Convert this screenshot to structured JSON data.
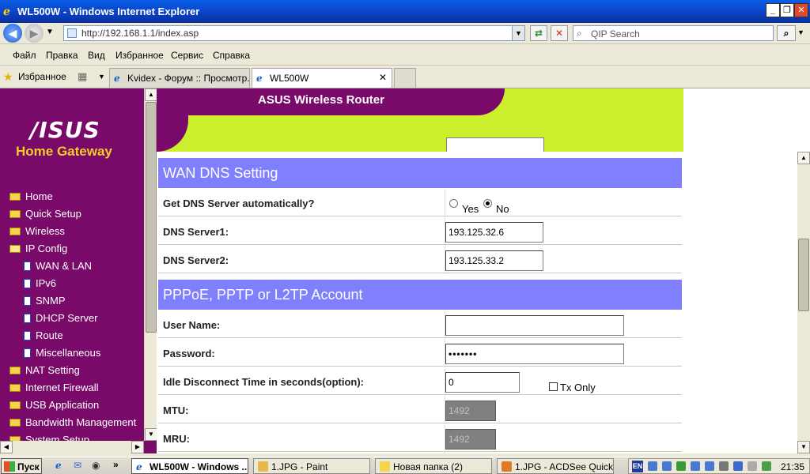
{
  "window": {
    "title": "WL500W - Windows Internet Explorer"
  },
  "browser": {
    "address": "http://192.168.1.1/index.asp",
    "search_placeholder": "QIP Search",
    "menu": [
      "Файл",
      "Правка",
      "Вид",
      "Избранное",
      "Сервис",
      "Справка"
    ],
    "favorites_label": "Избранное",
    "tabs": [
      {
        "label": "Kvidex - Форум :: Просмотр...",
        "active": false
      },
      {
        "label": "WL500W",
        "active": true
      }
    ]
  },
  "sidebar": {
    "logo": "/ISUS",
    "subtitle": "Home Gateway",
    "items": [
      {
        "label": "Home",
        "type": "folder",
        "level": 0
      },
      {
        "label": "Quick Setup",
        "type": "folder",
        "level": 0
      },
      {
        "label": "Wireless",
        "type": "folder",
        "level": 0
      },
      {
        "label": "IP Config",
        "type": "folder-open",
        "level": 0
      },
      {
        "label": "WAN & LAN",
        "type": "doc",
        "level": 1
      },
      {
        "label": "IPv6",
        "type": "doc",
        "level": 1
      },
      {
        "label": "SNMP",
        "type": "doc",
        "level": 1
      },
      {
        "label": "DHCP Server",
        "type": "doc",
        "level": 1
      },
      {
        "label": "Route",
        "type": "doc",
        "level": 1
      },
      {
        "label": "Miscellaneous",
        "type": "doc",
        "level": 1
      },
      {
        "label": "NAT Setting",
        "type": "folder",
        "level": 0
      },
      {
        "label": "Internet Firewall",
        "type": "folder",
        "level": 0
      },
      {
        "label": "USB Application",
        "type": "folder",
        "level": 0
      },
      {
        "label": "Bandwidth Management",
        "type": "folder",
        "level": 0
      },
      {
        "label": "System Setup",
        "type": "folder",
        "level": 0
      }
    ]
  },
  "main": {
    "banner_title": "ASUS Wireless Router",
    "dns_section": {
      "title": "WAN DNS Setting",
      "auto_label": "Get DNS Server automatically?",
      "yes_label": "Yes",
      "no_label": "No",
      "selected": "No",
      "dns1_label": "DNS Server1:",
      "dns1_value": "193.125.32.6",
      "dns2_label": "DNS Server2:",
      "dns2_value": "193.125.33.2"
    },
    "account_section": {
      "title": "PPPoE, PPTP or L2TP Account",
      "user_label": "User Name:",
      "user_value": "",
      "password_label": "Password:",
      "password_value": "•••••••",
      "idle_label": "Idle Disconnect Time in seconds(option):",
      "idle_value": "0",
      "tx_only_label": "Tx Only",
      "mtu_label": "MTU:",
      "mtu_value": "1492",
      "mru_label": "MRU:",
      "mru_value": "1492"
    }
  },
  "taskbar": {
    "start_label": "Пуск",
    "tasks": [
      {
        "label": "WL500W - Windows ...",
        "active": true
      },
      {
        "label": "1.JPG - Paint",
        "active": false
      },
      {
        "label": "Новая папка (2)",
        "active": false
      },
      {
        "label": "1.JPG - ACDSee Quick ...",
        "active": false
      }
    ],
    "lang": "EN",
    "clock": "21:35"
  }
}
